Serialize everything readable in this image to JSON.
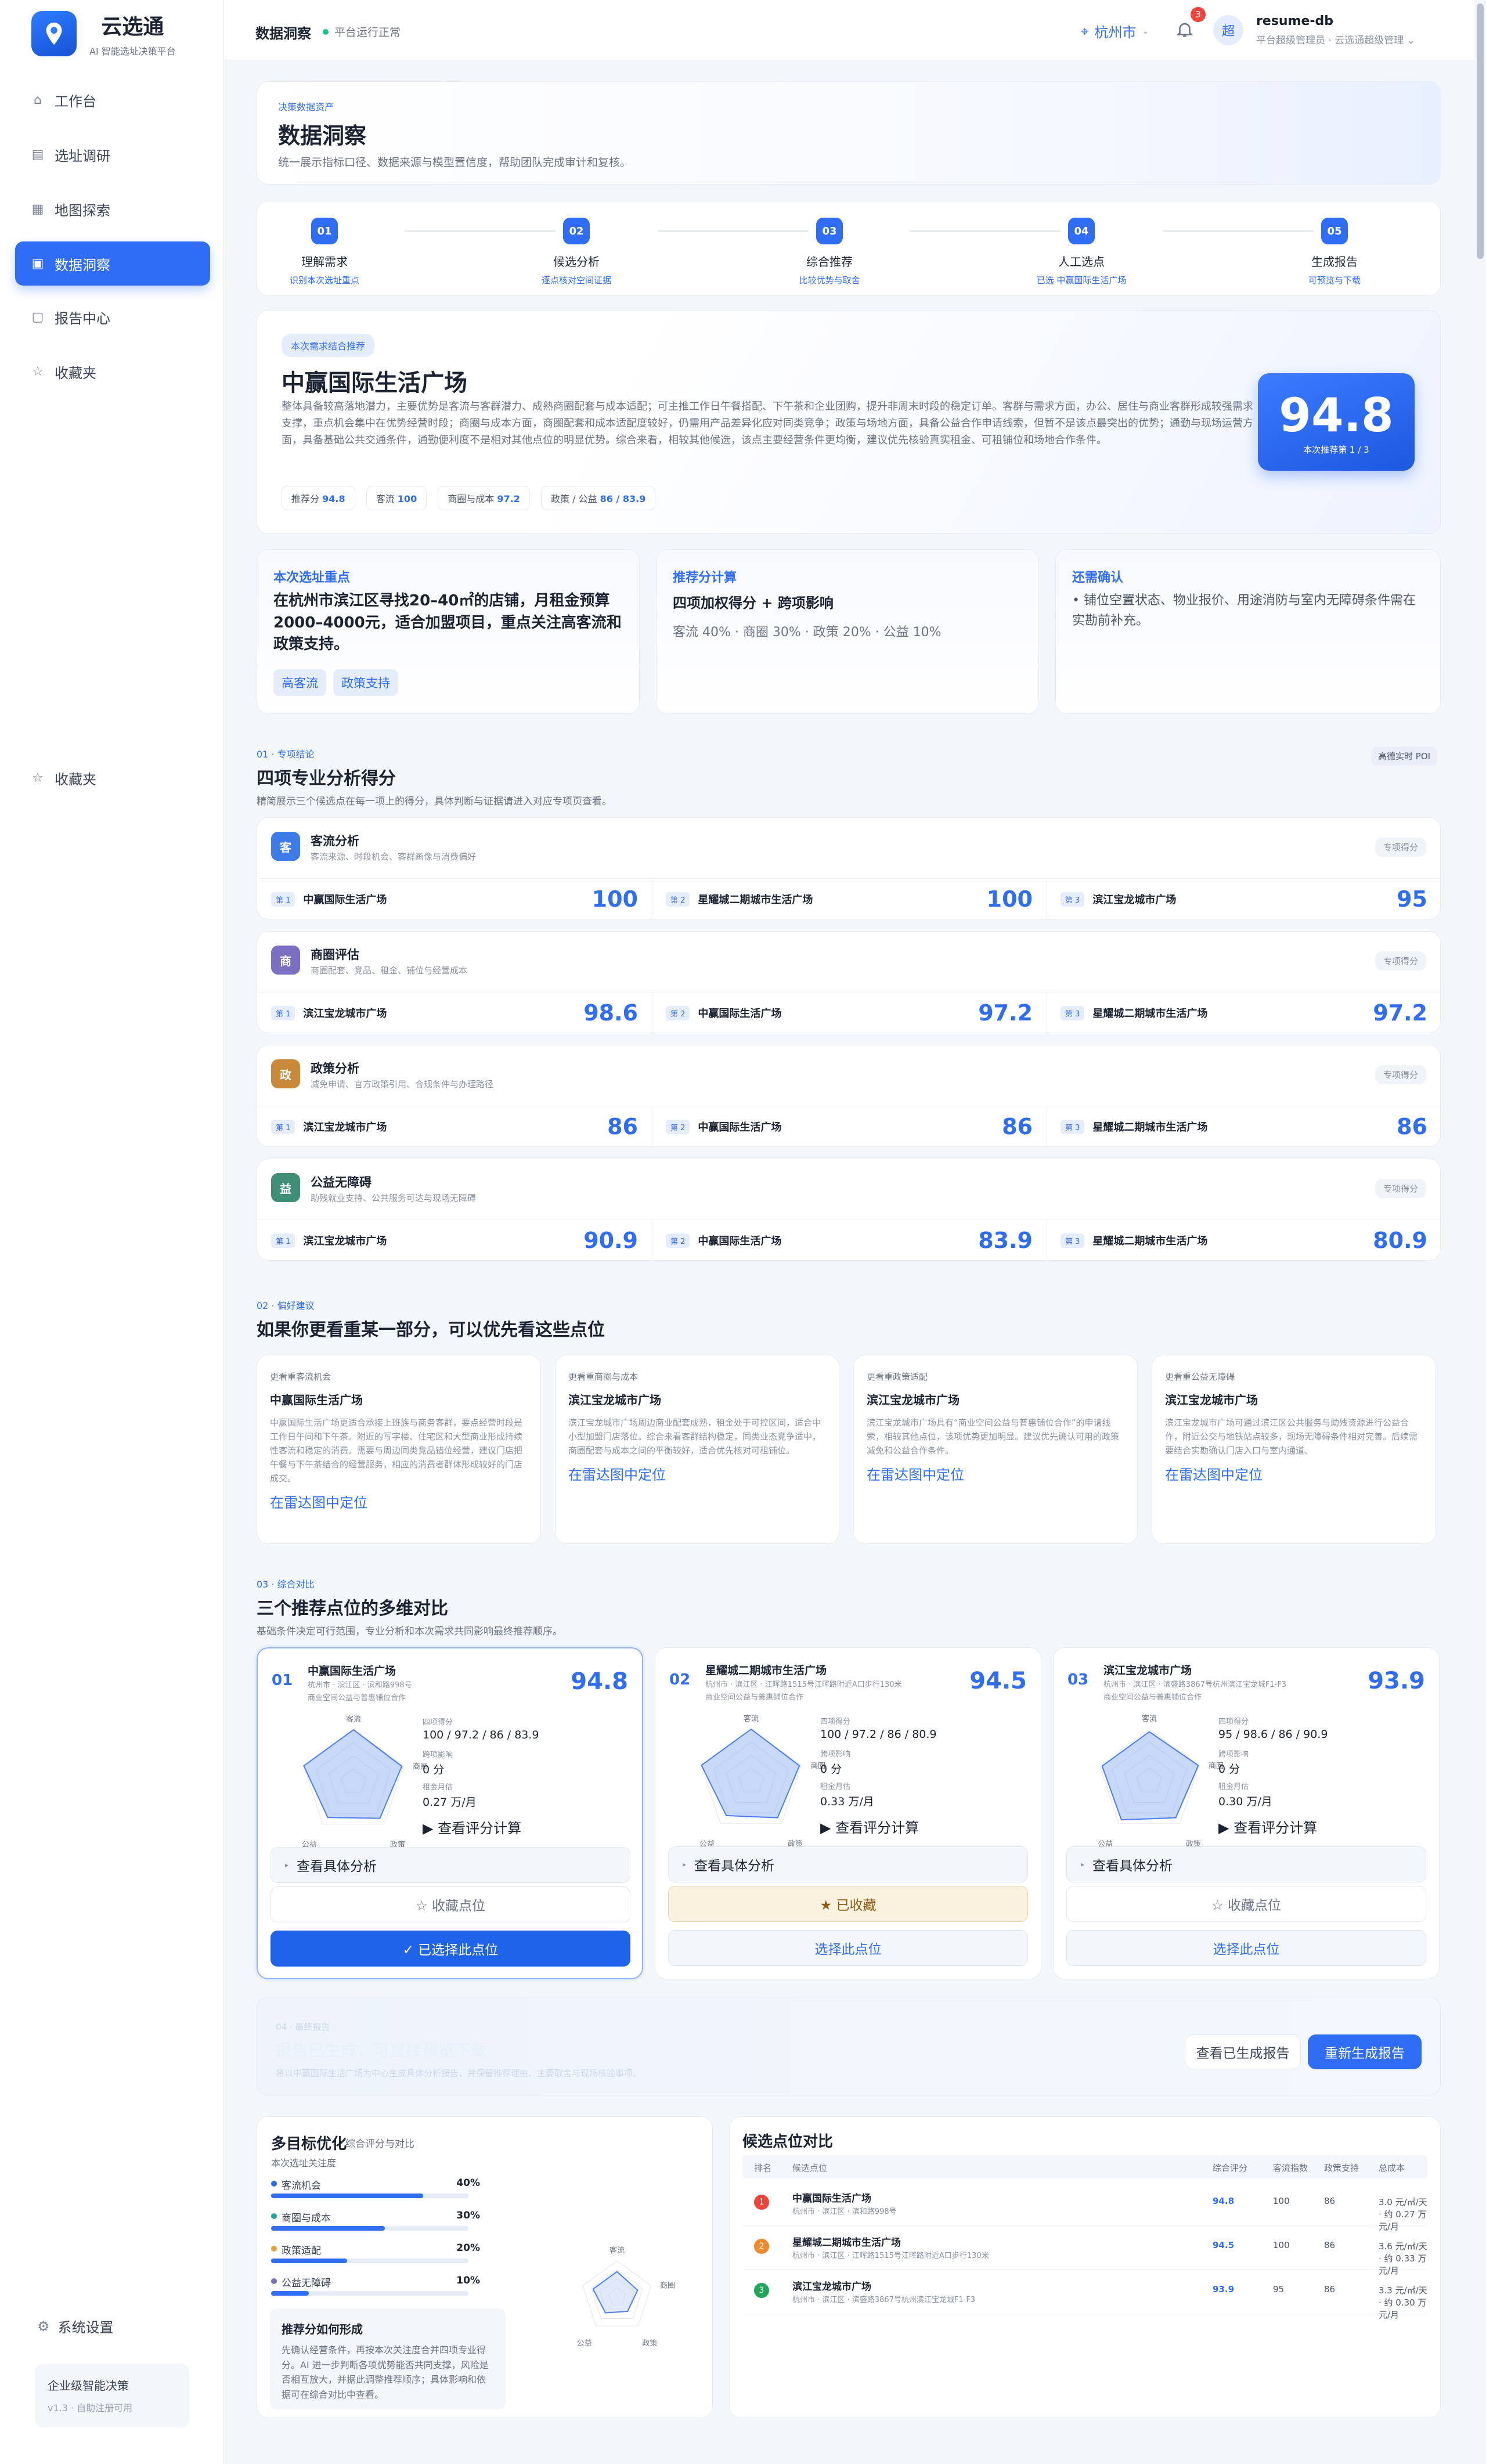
{
  "brand": {
    "name": "云选通",
    "sub": "AI 智能选址决策平台"
  },
  "nav": [
    {
      "label": "工作台",
      "icon": "home-icon"
    },
    {
      "label": "选址调研",
      "icon": "survey-icon"
    },
    {
      "label": "地图探索",
      "icon": "map-icon"
    },
    {
      "label": "数据洞察",
      "icon": "chart-icon"
    },
    {
      "label": "报告中心",
      "icon": "report-icon"
    },
    {
      "label": "收藏夹",
      "icon": "star-icon"
    }
  ],
  "nav_extra": {
    "favorites": "收藏夹",
    "settings": "系统设置"
  },
  "enterprise": {
    "title": "企业级智能决策",
    "sub": "v1.3 · 自助注册可用"
  },
  "topbar": {
    "title": "数据洞察",
    "status": "平台运行正常",
    "city": "杭州市",
    "notifications": "3",
    "avatar": "超",
    "user_name": "resume-db",
    "user_role": "平台超级管理员 · 云选通超级管理"
  },
  "hero": {
    "eyebrow": "决策数据资产",
    "title": "数据洞察",
    "desc": "统一展示指标口径、数据来源与模型置信度，帮助团队完成审计和复核。"
  },
  "steps": [
    {
      "num": "01",
      "title": "理解需求",
      "desc": "识别本次选址重点"
    },
    {
      "num": "02",
      "title": "候选分析",
      "desc": "逐点核对空间证据"
    },
    {
      "num": "03",
      "title": "综合推荐",
      "desc": "比较优势与取舍"
    },
    {
      "num": "04",
      "title": "人工选点",
      "desc": "已选 中赢国际生活广场"
    },
    {
      "num": "05",
      "title": "生成报告",
      "desc": "可预览与下载"
    }
  ],
  "recommend": {
    "pill": "本次需求结合推荐",
    "name": "中赢国际生活广场",
    "desc": "整体具备较高落地潜力，主要优势是客流与客群潜力、成熟商圈配套与成本适配；可主推工作日午餐搭配、下午茶和企业团购，提升非周末时段的稳定订单。客群与需求方面，办公、居住与商业客群形成较强需求支撑，重点机会集中在优势经营时段；商圈与成本方面，商圈配套和成本适配度较好，仍需用产品差异化应对同类竞争；政策与场地方面，具备公益合作申请线索，但暂不是该点最突出的优势；通勤与现场运营方面，具备基础公共交通条件，通勤便利度不是相对其他点位的明显优势。综合来看，相较其他候选，该点主要经营条件更均衡，建议优先核验真实租金、可租铺位和场地合作条件。",
    "chips": [
      {
        "k": "推荐分",
        "v": "94.8"
      },
      {
        "k": "客流",
        "v": "100"
      },
      {
        "k": "商圈与成本",
        "v": "97.2"
      },
      {
        "k": "政策 / 公益",
        "v": "86 / 83.9"
      }
    ],
    "score": "94.8",
    "score_label": "本次推荐第 1 / 3"
  },
  "info": [
    {
      "title": "本次选址重点",
      "body": "在杭州市滨江区寻找20–40㎡的店铺，月租金预算2000–4000元，适合加盟项目，重点关注高客流和政策支持。",
      "tags": [
        "高客流",
        "政策支持"
      ]
    },
    {
      "title": "推荐分计算",
      "body": "四项加权得分 + 跨项影响",
      "sub": "客流 40% · 商圈 30% · 政策 20% · 公益 10%"
    },
    {
      "title": "还需确认",
      "body": "铺位空置状态、物业报价、用途消防与室内无障碍条件需在实勘前补充。"
    }
  ],
  "section1": {
    "eyebrow": "01 · 专项结论",
    "title": "四项专业分析得分",
    "desc": "精简展示三个候选点在每一项上的得分，具体判断与证据请进入对应专项页查看。",
    "badge": "高德实时 POI"
  },
  "pro": [
    {
      "icon": "客",
      "color": "#3d7be8",
      "name": "客流分析",
      "desc": "客流来源、时段机会、客群画像与消费偏好",
      "tag": "专项得分",
      "rows": [
        {
          "rank": "第 1",
          "name": "中赢国际生活广场",
          "score": "100"
        },
        {
          "rank": "第 2",
          "name": "星耀城二期城市生活广场",
          "score": "100"
        },
        {
          "rank": "第 3",
          "name": "滨江宝龙城市广场",
          "score": "95"
        }
      ]
    },
    {
      "icon": "商",
      "color": "#7b6fc4",
      "name": "商圈评估",
      "desc": "商圈配套、竞品、租金、铺位与经营成本",
      "tag": "专项得分",
      "rows": [
        {
          "rank": "第 1",
          "name": "滨江宝龙城市广场",
          "score": "98.6"
        },
        {
          "rank": "第 2",
          "name": "中赢国际生活广场",
          "score": "97.2"
        },
        {
          "rank": "第 3",
          "name": "星耀城二期城市生活广场",
          "score": "97.2"
        }
      ]
    },
    {
      "icon": "政",
      "color": "#c9893a",
      "name": "政策分析",
      "desc": "减免申请、官方政策引用、合规条件与办理路径",
      "tag": "专项得分",
      "rows": [
        {
          "rank": "第 1",
          "name": "滨江宝龙城市广场",
          "score": "86"
        },
        {
          "rank": "第 2",
          "name": "中赢国际生活广场",
          "score": "86"
        },
        {
          "rank": "第 3",
          "name": "星耀城二期城市生活广场",
          "score": "86"
        }
      ]
    },
    {
      "icon": "益",
      "color": "#3f8f76",
      "name": "公益无障碍",
      "desc": "助残就业支持、公共服务可达与现场无障碍",
      "tag": "专项得分",
      "rows": [
        {
          "rank": "第 1",
          "name": "滨江宝龙城市广场",
          "score": "90.9"
        },
        {
          "rank": "第 2",
          "name": "中赢国际生活广场",
          "score": "83.9"
        },
        {
          "rank": "第 3",
          "name": "星耀城二期城市生活广场",
          "score": "80.9"
        }
      ]
    }
  ],
  "section2": {
    "eyebrow": "02 · 偏好建议",
    "title": "如果你更看重某一部分，可以优先看这些点位"
  },
  "prefs": [
    {
      "eyebrow": "更看重客流机会",
      "name": "中赢国际生活广场",
      "text": "中赢国际生活广场更适合承接上班族与商务客群，要点经营时段是工作日午间和下午茶。附近的写字楼、住宅区和大型商业形成持续性客流和稳定的消费。需要与周边同类竞品错位经营，建议门店把午餐与下午茶结合的经营服务，相应的消费者群体形成较好的门店成交。",
      "link": "在雷达图中定位"
    },
    {
      "eyebrow": "更看重商圈与成本",
      "name": "滨江宝龙城市广场",
      "text": "滨江宝龙城市广场周边商业配套成熟，租金处于可控区间，适合中小型加盟门店落位。综合来看客群结构稳定，同类业态竞争适中，商圈配套与成本之间的平衡较好，适合优先核对可租铺位。",
      "link": "在雷达图中定位"
    },
    {
      "eyebrow": "更看重政策适配",
      "name": "滨江宝龙城市广场",
      "text": "滨江宝龙城市广场具有“商业空间公益与普惠铺位合作”的申请线索，相较其他点位，该项优势更加明显。建议优先确认可用的政策减免和公益合作条件。",
      "link": "在雷达图中定位"
    },
    {
      "eyebrow": "更看重公益无障碍",
      "name": "滨江宝龙城市广场",
      "text": "滨江宝龙城市广场可通过滨江区公共服务与助残资源进行公益合作，附近公交与地铁站点较多，现场无障碍条件相对完善。后续需要结合实勘确认门店入口与室内通道。",
      "link": "在雷达图中定位"
    }
  ],
  "section3": {
    "eyebrow": "03 · 综合对比",
    "title": "三个推荐点位的多维对比",
    "desc": "基础条件决定可行范围，专业分析和本次需求共同影响最终推荐顺序。"
  },
  "compare": [
    {
      "idx": "01",
      "name": "中赢国际生活广场",
      "addr": "杭州市 · 滨江区 · 滨和路998号",
      "note": "商业空间公益与普惠铺位合作",
      "score": "94.8",
      "m1k": "四项得分",
      "m1v": "100 / 97.2 / 86 / 83.9",
      "m2k": "跨项影响",
      "m2v": "0 分",
      "m3k": "租金月估",
      "m3v": "0.27 万/月",
      "calc": "▶ 查看评分计算",
      "detail": "查看具体分析",
      "fav": "☆ 收藏点位",
      "sel": "✓ 已选择此点位",
      "fav_on": false,
      "sel_on": true,
      "axes": [
        "客流",
        "商圈",
        "政策",
        "公益"
      ]
    },
    {
      "idx": "02",
      "name": "星耀城二期城市生活广场",
      "addr": "杭州市 · 滨江区 · 江晖路1515号江晖路附近A口步行130米",
      "note": "商业空间公益与普惠铺位合作",
      "score": "94.5",
      "m1k": "四项得分",
      "m1v": "100 / 97.2 / 86 / 80.9",
      "m2k": "跨项影响",
      "m2v": "0 分",
      "m3k": "租金月估",
      "m3v": "0.33 万/月",
      "calc": "▶ 查看评分计算",
      "detail": "查看具体分析",
      "fav": "★ 已收藏",
      "sel": "选择此点位",
      "fav_on": true,
      "sel_on": false,
      "axes": [
        "客流",
        "商圈",
        "政策",
        "公益"
      ]
    },
    {
      "idx": "03",
      "name": "滨江宝龙城市广场",
      "addr": "杭州市 · 滨江区 · 滨盛路3867号杭州滨江宝龙城F1-F3",
      "note": "商业空间公益与普惠铺位合作",
      "score": "93.9",
      "m1k": "四项得分",
      "m1v": "95 / 98.6 / 86 / 90.9",
      "m2k": "跨项影响",
      "m2v": "0 分",
      "m3k": "租金月估",
      "m3v": "0.30 万/月",
      "calc": "▶ 查看评分计算",
      "detail": "查看具体分析",
      "fav": "☆ 收藏点位",
      "sel": "选择此点位",
      "fav_on": false,
      "sel_on": false,
      "axes": [
        "客流",
        "商圈",
        "政策",
        "公益"
      ]
    }
  ],
  "report": {
    "eyebrow": "04 · 最终报告",
    "title": "报告已生成，可直接预览下载",
    "desc": "将以中赢国际生活广场为中心生成具体分析报告，并保留推荐理由、主要取舍与现场核验事项。",
    "view": "查看已生成报告",
    "regen": "重新生成报告"
  },
  "multi": {
    "title": "多目标优化",
    "subtitle": "综合评分与对比",
    "note": "本次选址关注度",
    "weights": [
      {
        "name": "客流机会",
        "pct": "40%",
        "val": 0.4,
        "color": "#2f6df6"
      },
      {
        "name": "商圈与成本",
        "pct": "30%",
        "val": 0.3,
        "color": "#22a6a0"
      },
      {
        "name": "政策适配",
        "pct": "20%",
        "val": 0.2,
        "color": "#e0a43a"
      },
      {
        "name": "公益无障碍",
        "pct": "10%",
        "val": 0.1,
        "color": "#7b6fc4"
      }
    ],
    "radar_axes": [
      "客流",
      "商圈",
      "政策",
      "公益"
    ],
    "how_title": "推荐分如何形成",
    "how_body": "先确认经营条件，再按本次关注度合并四项专业得分。AI 进一步判断各项优势能否共同支撑，风险是否相互放大，并据此调整推荐顺序；具体影响和依据可在综合对比中查看。"
  },
  "cand": {
    "title": "候选点位对比",
    "headers": [
      "排名",
      "候选点位",
      "综合评分",
      "客流指数",
      "政策支持",
      "总成本"
    ],
    "rows": [
      {
        "rank": "1",
        "color": "#f0443c",
        "name": "中赢国际生活广场",
        "addr": "杭州市 · 滨江区 · 滨和路998号",
        "score": "94.8",
        "flow": "100",
        "policy": "86",
        "cost": "3.0 元/㎡/天 · 约 0.27 万元/月"
      },
      {
        "rank": "2",
        "color": "#f08a2c",
        "name": "星耀城二期城市生活广场",
        "addr": "杭州市 · 滨江区 · 江晖路1515号江晖路附近A口步行130米",
        "score": "94.5",
        "flow": "100",
        "policy": "86",
        "cost": "3.6 元/㎡/天 · 约 0.33 万元/月"
      },
      {
        "rank": "3",
        "color": "#22a65a",
        "name": "滨江宝龙城市广场",
        "addr": "杭州市 · 滨江区 · 滨盛路3867号杭州滨江宝龙城F1-F3",
        "score": "93.9",
        "flow": "95",
        "policy": "86",
        "cost": "3.3 元/㎡/天 · 约 0.30 万元/月"
      }
    ]
  }
}
